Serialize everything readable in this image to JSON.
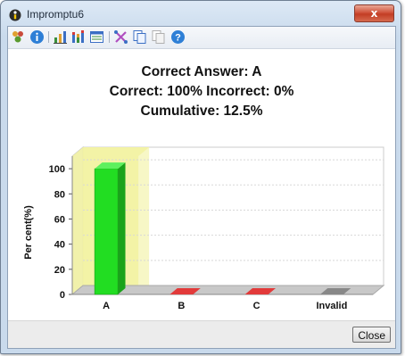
{
  "window": {
    "title": "Impromptu6",
    "close_glyph": "x"
  },
  "toolbar": {
    "icons": [
      "people-icon",
      "info-icon",
      "bar-chart-icon",
      "stacked-bar-icon",
      "table-view-icon",
      "crossover-icon",
      "copy-icon",
      "copy-disabled-icon",
      "help-icon"
    ]
  },
  "summary": {
    "correct_answer": "Correct Answer: A",
    "scores": "Correct: 100%  Incorrect: 0%",
    "cumulative": "Cumulative: 12.5%"
  },
  "footer": {
    "close_label": "Close"
  },
  "colors": {
    "correct": "#22dd22",
    "wrong": "#e23a3a",
    "invalid": "#888888",
    "highlight": "#f2f2a0"
  },
  "chart_data": {
    "type": "bar",
    "categories": [
      "A",
      "B",
      "C",
      "Invalid"
    ],
    "values": [
      100,
      0,
      0,
      0
    ],
    "highlight_category": "A",
    "ylabel": "Per cent(%)",
    "ylim": [
      0,
      110
    ],
    "yticks": [
      0,
      20,
      40,
      60,
      80,
      100
    ],
    "grid": true
  }
}
